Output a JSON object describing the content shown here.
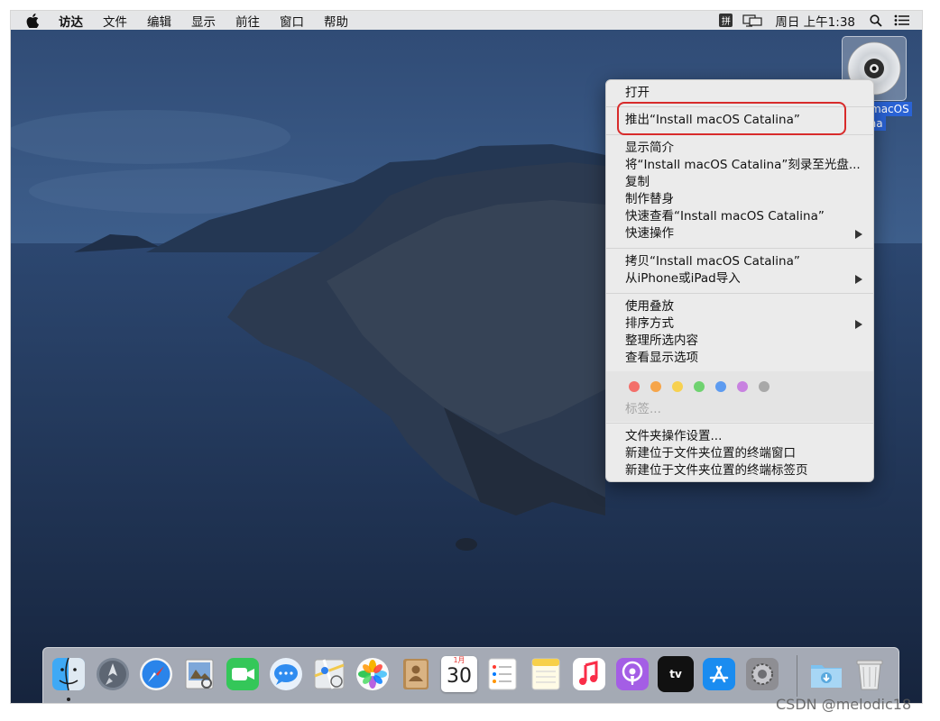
{
  "menubar": {
    "items": [
      "访达",
      "文件",
      "编辑",
      "显示",
      "前往",
      "窗口",
      "帮助"
    ],
    "ime_label": "拼",
    "clock": "周日 上午1:38"
  },
  "desktop": {
    "disk_label_line1": "macOS",
    "disk_label_line2": "lina"
  },
  "context_menu": {
    "open": "打开",
    "eject": "推出“Install macOS Catalina”",
    "get_info": "显示简介",
    "burn": "将“Install macOS Catalina”刻录至光盘...",
    "duplicate": "复制",
    "make_alias": "制作替身",
    "quick_look": "快速查看“Install macOS Catalina”",
    "quick_actions": "快速操作",
    "copy": "拷贝“Install macOS Catalina”",
    "import_iphone": "从iPhone或iPad导入",
    "use_stacks": "使用叠放",
    "sort_by": "排序方式",
    "clean_up": "整理所选内容",
    "view_options": "查看显示选项",
    "tags_placeholder": "标签...",
    "folder_actions": "文件夹操作设置...",
    "new_terminal": "新建位于文件夹位置的终端窗口",
    "new_terminal_tab": "新建位于文件夹位置的终端标签页",
    "tag_colors": [
      "#f36f6a",
      "#f6a54a",
      "#f7d150",
      "#6fd270",
      "#5d9bf0",
      "#c882e0",
      "#a8a8a8"
    ]
  },
  "dock": {
    "apps": [
      "finder",
      "launchpad",
      "safari",
      "preview",
      "facetime",
      "messages",
      "maps",
      "photos",
      "contacts",
      "calendar",
      "reminders",
      "notes",
      "music",
      "podcasts",
      "tv",
      "app-store",
      "system-preferences",
      "downloads",
      "trash"
    ],
    "calendar_month": "1月",
    "calendar_day": "30",
    "tv_label": "tv"
  },
  "watermark": "CSDN @melodic18"
}
